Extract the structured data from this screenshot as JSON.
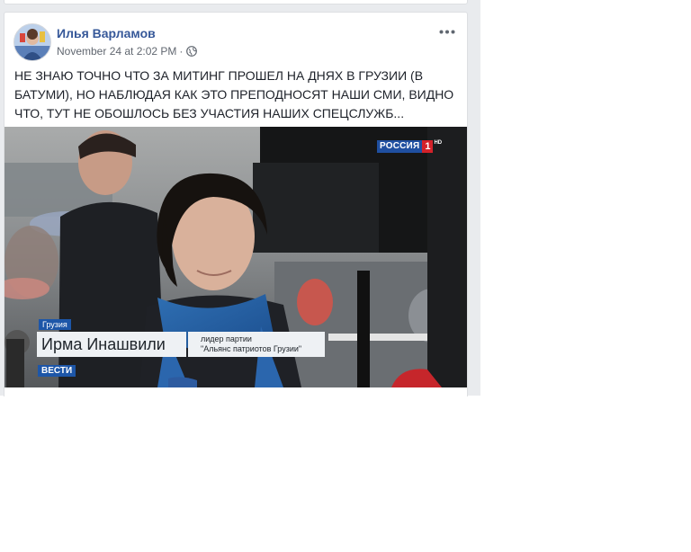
{
  "post": {
    "author": "Илья Варламов",
    "timestamp": "November 24 at 2:02 PM",
    "separator": "·",
    "privacy_icon": "globe-icon",
    "more_icon": "more-options-icon",
    "text": "НЕ ЗНАЮ ТОЧНО ЧТО ЗА МИТИНГ ПРОШЕЛ НА ДНЯХ В ГРУЗИИ (В БАТУМИ), НО НАБЛЮДАЯ КАК ЭТО ПРЕПОДНОСЯТ НАШИ СМИ, ВИДНО ЧТО, ТУТ НЕ ОБОШЛОСЬ БЕЗ УЧАСТИЯ НАШИХ СПЕЦСЛУЖБ..."
  },
  "photo": {
    "channel_logo": {
      "word": "РОССИЯ",
      "number": "1",
      "hd": "HD"
    },
    "lower_third": {
      "region": "Грузия",
      "name": "Ирма Инашвили",
      "role_line1": "лидер партии",
      "role_line2": "\"Альянс патриотов Грузии\"",
      "brand": "ВЕСТИ"
    }
  },
  "colors": {
    "feed_background": "#e9ebee",
    "author_link": "#365899",
    "brand_blue": "#1d56a8",
    "channel_red": "#d3222a"
  }
}
